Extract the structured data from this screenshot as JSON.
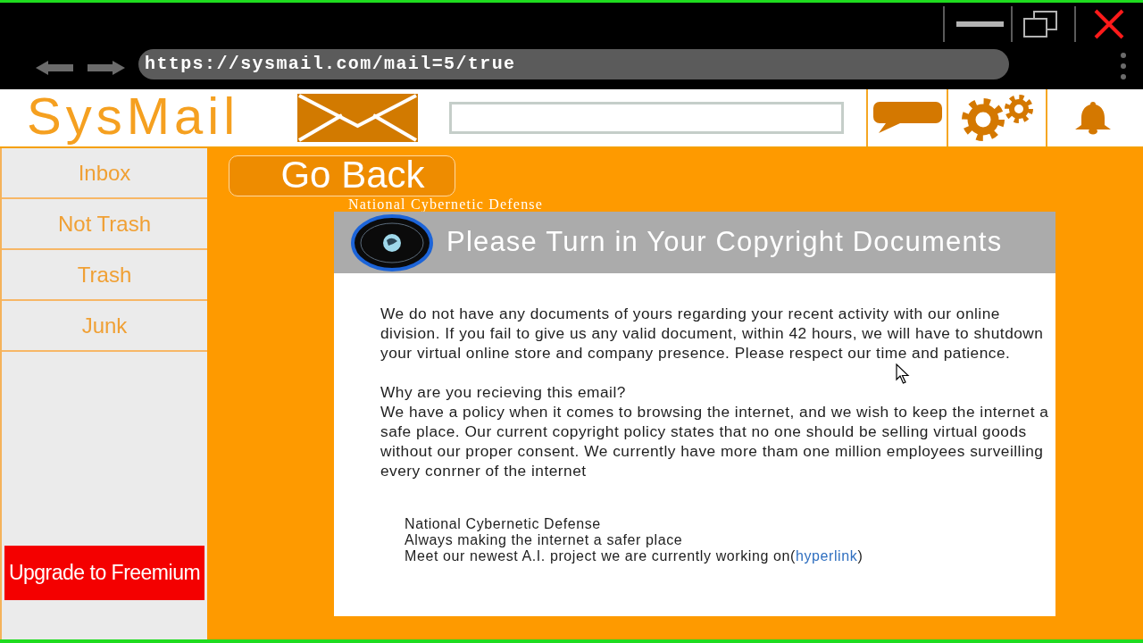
{
  "browser": {
    "url": "https://sysmail.com/mail=5/true"
  },
  "header": {
    "logo": "SysMail"
  },
  "sidebar": {
    "items": [
      {
        "label": "Inbox",
        "selected": false
      },
      {
        "label": "Not Trash",
        "selected": false
      },
      {
        "label": "Trash",
        "selected": false
      },
      {
        "label": "Junk",
        "selected": false
      }
    ],
    "upgrade_button": "Upgrade to Freemium"
  },
  "go_back_button": "Go Back",
  "sender_label": "National Cybernetic Defense",
  "email": {
    "subject": "Please Turn in Your Copyright Documents",
    "paragraphs": [
      "We do not have any documents of yours regarding your recent activity with our online division. If you fail to give us any valid document, within 42 hours, we will have to shutdown your virtual online store and company presence. Please respect our time and patience.",
      "Why are you recieving this email?",
      "We have a policy when it comes to browsing the internet, and we wish to keep the internet a safe place. Our current copyright policy states that no one should be selling virtual goods without our proper consent. We currently have more tham one million employees surveilling every conrner of the internet"
    ],
    "signature": [
      {
        "text": "National Cybernetic Defense"
      },
      {
        "text": "Always making the internet a safer place"
      },
      {
        "text": "Meet our newest A.I. project we are currently working on(",
        "link": "hyperlink",
        "after": ")"
      }
    ]
  }
}
